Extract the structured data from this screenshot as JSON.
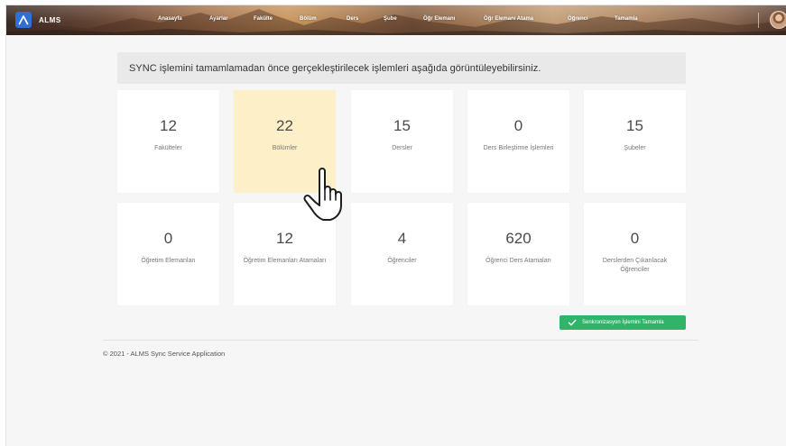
{
  "app": {
    "brand": "ALMS"
  },
  "nav": {
    "items": [
      "Anasayfa",
      "Ayarlar",
      "Fakülte",
      "Bölüm",
      "Ders",
      "Şube",
      "Öğr Elemanı",
      "Öğr Elemanı Atama",
      "Öğrenci",
      "Tamamla"
    ]
  },
  "banner": {
    "text": "SYNC işlemini tamamlamadan önce gerçekleştirilecek işlemleri aşağıda görüntüleyebilirsiniz."
  },
  "cards": [
    {
      "value": "12",
      "label": "Fakülteler"
    },
    {
      "value": "22",
      "label": "Bölümler"
    },
    {
      "value": "15",
      "label": "Dersler"
    },
    {
      "value": "0",
      "label": "Ders Birleştirme İşlemleri"
    },
    {
      "value": "15",
      "label": "Şubeler"
    },
    {
      "value": "0",
      "label": "Öğretim Elemanları"
    },
    {
      "value": "12",
      "label": "Öğretim Elemanları Atamaları"
    },
    {
      "value": "4",
      "label": "Öğrenciler"
    },
    {
      "value": "620",
      "label": "Öğrenci Ders Atamaları"
    },
    {
      "value": "0",
      "label": "Derslerden Çıkarılacak Öğrenciler"
    }
  ],
  "actions": {
    "sync_complete": "Senkronizasyon İşlemini Tamamla"
  },
  "footer": {
    "text": "© 2021 - ALMS Sync Service Application"
  },
  "colors": {
    "accent": "#2fb46a",
    "highlight": "#fdf0c8",
    "brand": "#2f6fd6"
  },
  "icons": {
    "brand": "alms-logo-icon",
    "user": "avatar",
    "cursor": "hand-pointer-icon",
    "sync": "check-icon"
  }
}
